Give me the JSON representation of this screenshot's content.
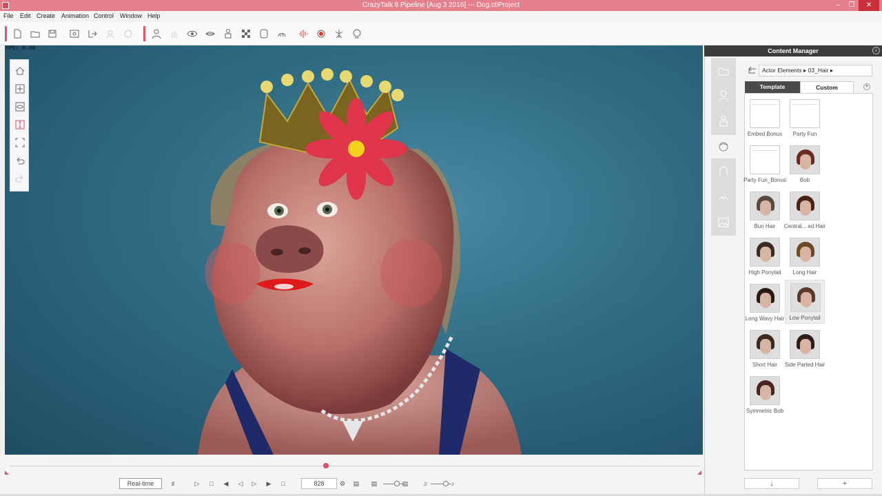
{
  "window": {
    "title": "CrazyTalk 8 Pipeline [Aug  3 2016] --- Dog.ctiProject"
  },
  "menu": [
    "File",
    "Edit",
    "Create",
    "Animation",
    "Control",
    "Window",
    "Help"
  ],
  "viewport": {
    "fps": "FPS: 0.00"
  },
  "timeline": {
    "mode": "Real-time",
    "frame": "828",
    "progress": 0.46
  },
  "panel": {
    "title": "Content Manager",
    "breadcrumb": [
      "Actor Elements",
      "03_Hair"
    ],
    "tabs": [
      "Template",
      "Custom"
    ],
    "active_tab": "Custom",
    "items": [
      {
        "label": "Embed Bonus",
        "kind": "folder"
      },
      {
        "label": "Party Fun",
        "kind": "folder"
      },
      {
        "label": "Party Fun_Bonus",
        "kind": "folder"
      },
      {
        "label": "Bob",
        "kind": "hair",
        "color": "#6b2a22"
      },
      {
        "label": "Bun Hair",
        "kind": "hair",
        "color": "#5a4a3e"
      },
      {
        "label": "Central... ed Hair",
        "kind": "hair",
        "color": "#4a2418"
      },
      {
        "label": "High Ponytail",
        "kind": "hair",
        "color": "#3a2a22"
      },
      {
        "label": "Long Hair",
        "kind": "hair",
        "color": "#6a4a2a"
      },
      {
        "label": "Long Wavy Hair",
        "kind": "hair",
        "color": "#2a1a14"
      },
      {
        "label": "Low Ponytail",
        "kind": "hair",
        "color": "#5a3a2a",
        "selected": true
      },
      {
        "label": "Short Hair",
        "kind": "hair",
        "color": "#3a2a20"
      },
      {
        "label": "Side Parted Hair",
        "kind": "hair",
        "color": "#2e1e18"
      },
      {
        "label": "Symmetric Bob",
        "kind": "hair",
        "color": "#4a2420"
      }
    ]
  },
  "colors": {
    "accent": "#e3506a",
    "titlebar": "#e47f8c",
    "panel_header": "#3c3c3c"
  }
}
